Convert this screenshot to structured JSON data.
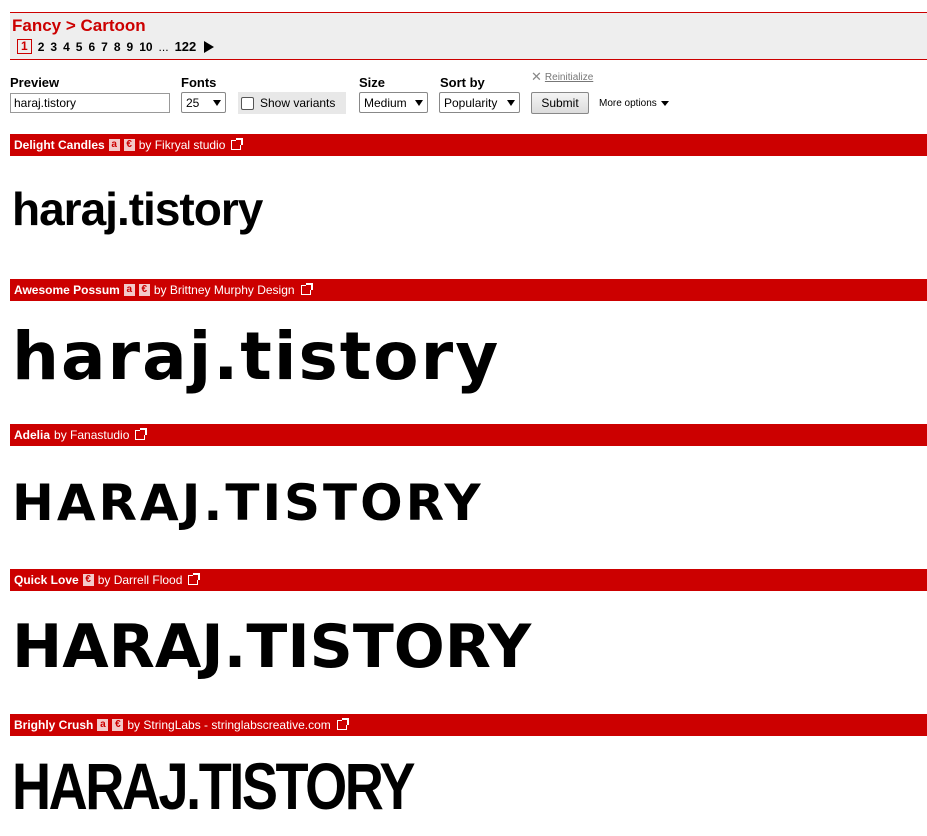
{
  "breadcrumb": {
    "parent": "Fancy",
    "sep": " > ",
    "current": "Cartoon"
  },
  "pager": {
    "pages": [
      "1",
      "2",
      "3",
      "4",
      "5",
      "6",
      "7",
      "8",
      "9",
      "10"
    ],
    "ellipsis": "...",
    "last": "122"
  },
  "form": {
    "preview_label": "Preview",
    "preview_value": "haraj.tistory",
    "fonts_label": "Fonts",
    "fonts_value": "25",
    "variants_label": "Show variants",
    "size_label": "Size",
    "size_value": "Medium",
    "sort_label": "Sort by",
    "sort_value": "Popularity",
    "submit_label": "Submit",
    "reinit_label": "Reinitialize",
    "more_label": "More options"
  },
  "fonts": [
    {
      "name": "Delight Candles",
      "lic": [
        "a",
        "€"
      ],
      "author": "by Fikryal studio",
      "sample": "haraj.tistory"
    },
    {
      "name": "Awesome Possum",
      "lic": [
        "a",
        "€"
      ],
      "author": "by Brittney Murphy Design",
      "sample": "haraj.tistory"
    },
    {
      "name": "Adelia",
      "lic": [],
      "author": "by Fanastudio",
      "sample": "HARAJ.TISTORY"
    },
    {
      "name": "Quick Love",
      "lic": [
        "€"
      ],
      "author": "by Darrell Flood",
      "sample": "HARAJ.TISTORY"
    },
    {
      "name": "Brighly Crush",
      "lic": [
        "a",
        "€"
      ],
      "author": "by StringLabs - stringlabscreative.com",
      "sample": "HARAJ.TISTORY"
    }
  ]
}
